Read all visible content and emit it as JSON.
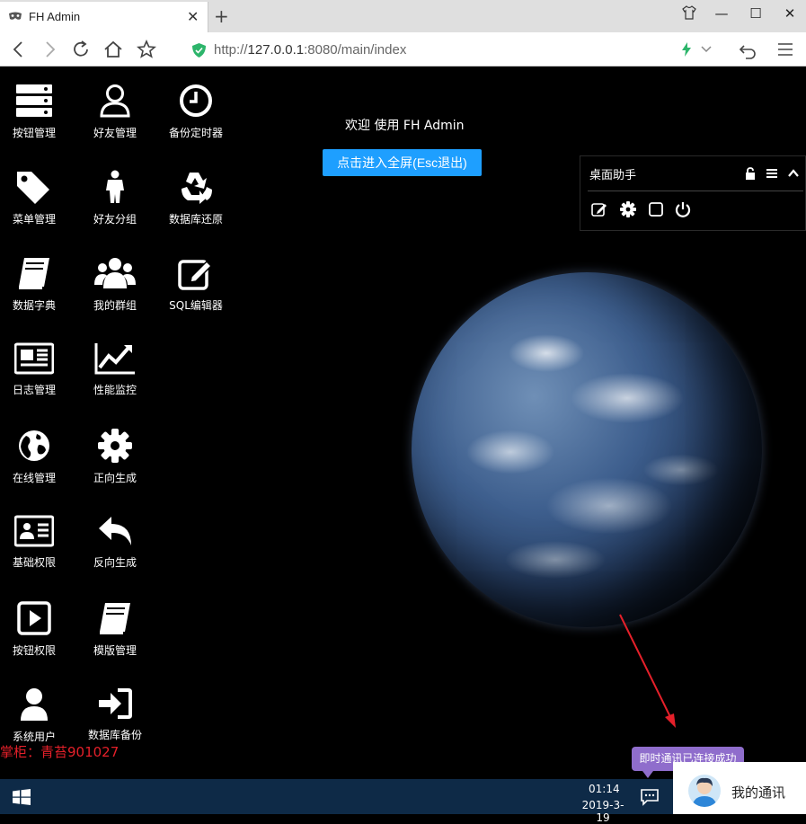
{
  "browser": {
    "tab_title": "FH Admin",
    "url_prefix": "http://",
    "url_host": "127.0.0.1",
    "url_rest": ":8080/main/index"
  },
  "desktop_icons": [
    {
      "label": "按钮管理",
      "icon": "server-icon"
    },
    {
      "label": "好友管理",
      "icon": "user-outline-icon"
    },
    {
      "label": "备份定时器",
      "icon": "clock-icon"
    },
    {
      "label": "菜单管理",
      "icon": "tags-icon"
    },
    {
      "label": "好友分组",
      "icon": "male-icon"
    },
    {
      "label": "数据库还原",
      "icon": "recycle-icon"
    },
    {
      "label": "数据字典",
      "icon": "book-icon"
    },
    {
      "label": "我的群组",
      "icon": "users-icon"
    },
    {
      "label": "SQL编辑器",
      "icon": "edit-icon"
    },
    {
      "label": "日志管理",
      "icon": "newspaper-icon"
    },
    {
      "label": "性能监控",
      "icon": "line-chart-icon"
    },
    {
      "label": "在线管理",
      "icon": "globe-icon"
    },
    {
      "label": "正向生成",
      "icon": "cog-icon"
    },
    {
      "label": "基础权限",
      "icon": "id-card-icon"
    },
    {
      "label": "反向生成",
      "icon": "reply-icon"
    },
    {
      "label": "按钮权限",
      "icon": "play-square-icon"
    },
    {
      "label": "模版管理",
      "icon": "book-icon"
    },
    {
      "label": "系统用户",
      "icon": "user-icon"
    },
    {
      "label": "数据库备份",
      "icon": "sign-in-icon"
    }
  ],
  "main": {
    "welcome": "欢迎 使用 FH Admin",
    "fullscreen_button": "点击进入全屏(Esc退出)"
  },
  "assistant": {
    "title": "桌面助手"
  },
  "watermark": "掌柜：青苔901027",
  "toast": "即时通讯已连接成功",
  "taskbar": {
    "time": "01:14",
    "date": "2019-3-19"
  },
  "im": {
    "label": "我的通讯"
  },
  "colors": {
    "accent": "#1e9fff",
    "toast": "#8f6dcc",
    "taskbar": "#0e2a47",
    "watermark": "#e5202a"
  }
}
